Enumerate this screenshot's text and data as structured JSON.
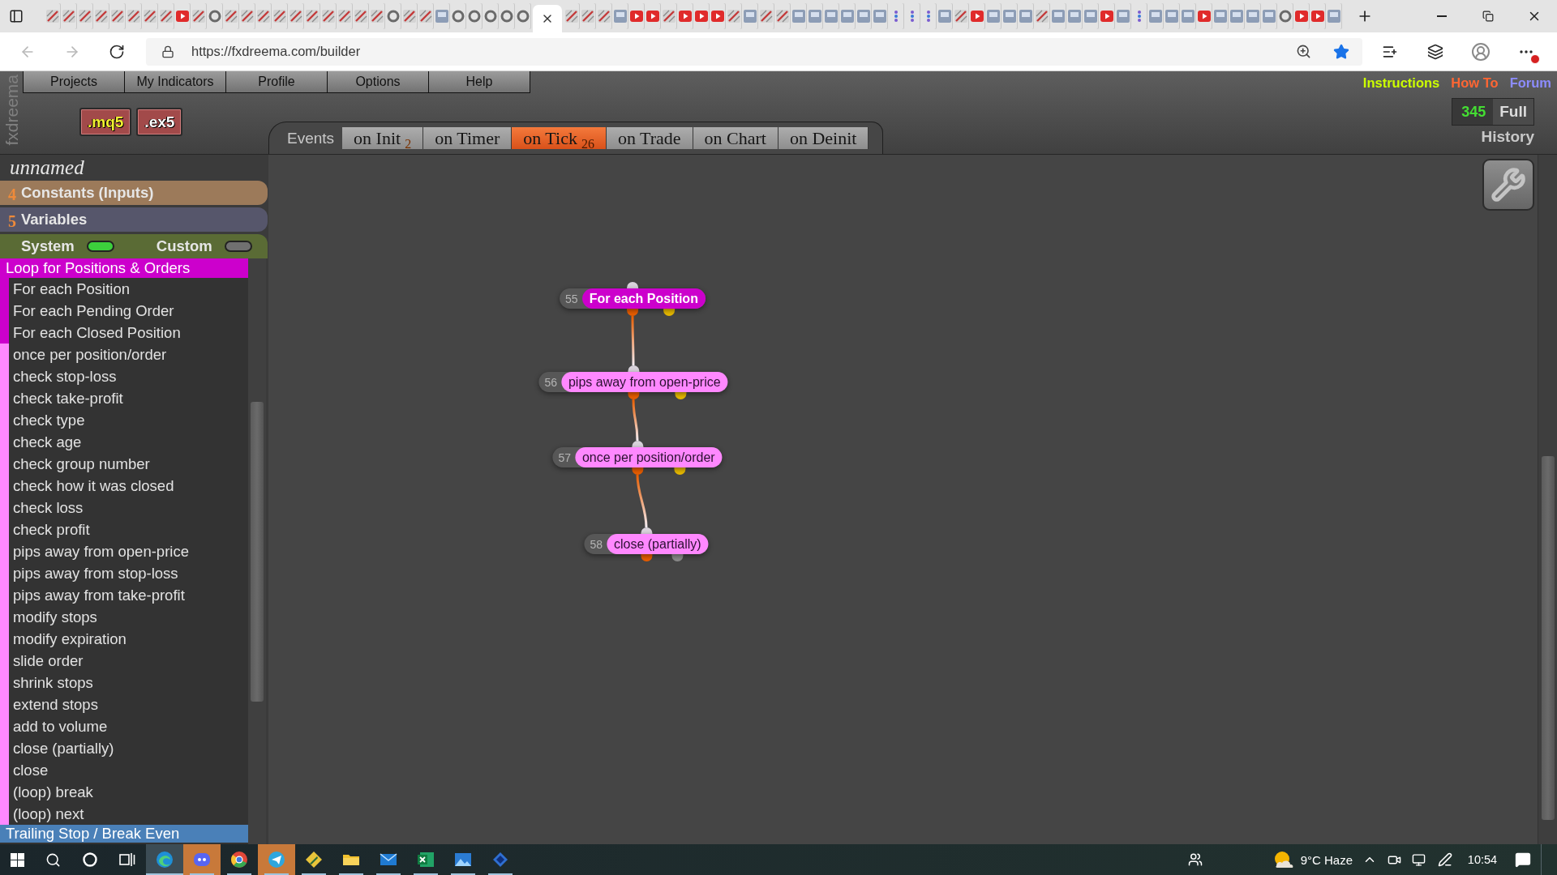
{
  "browser": {
    "tabs": [
      {
        "kind": "pencil",
        "selected": false
      },
      {
        "kind": "pencil",
        "selected": false
      },
      {
        "kind": "pencil",
        "selected": false
      },
      {
        "kind": "pencil",
        "selected": false
      },
      {
        "kind": "pencil",
        "selected": false
      },
      {
        "kind": "pencil",
        "selected": false
      },
      {
        "kind": "pencil",
        "selected": false
      },
      {
        "kind": "pencil",
        "selected": false
      },
      {
        "kind": "play",
        "selected": false
      },
      {
        "kind": "pencil",
        "selected": false
      },
      {
        "kind": "ring",
        "selected": false
      },
      {
        "kind": "pencil",
        "selected": false
      },
      {
        "kind": "pencil",
        "selected": false
      },
      {
        "kind": "pencil",
        "selected": false
      },
      {
        "kind": "pencil",
        "selected": false
      },
      {
        "kind": "pencil",
        "selected": false
      },
      {
        "kind": "pencil",
        "selected": false
      },
      {
        "kind": "pencil",
        "selected": false
      },
      {
        "kind": "pencil",
        "selected": false
      },
      {
        "kind": "pencil",
        "selected": false
      },
      {
        "kind": "pencil",
        "selected": false
      },
      {
        "kind": "ring",
        "selected": false
      },
      {
        "kind": "pencil",
        "selected": false
      },
      {
        "kind": "pencil",
        "selected": false
      },
      {
        "kind": "tile",
        "selected": false
      },
      {
        "kind": "ring",
        "selected": false
      },
      {
        "kind": "ring",
        "selected": false
      },
      {
        "kind": "ring",
        "selected": false
      },
      {
        "kind": "ring",
        "selected": false
      },
      {
        "kind": "ring",
        "selected": false
      },
      {
        "selected": true
      },
      {
        "kind": "pencil",
        "selected": false
      },
      {
        "kind": "pencil",
        "selected": false
      },
      {
        "kind": "pencil",
        "selected": false
      },
      {
        "kind": "tile",
        "selected": false
      },
      {
        "kind": "play",
        "selected": false
      },
      {
        "kind": "play",
        "selected": false
      },
      {
        "kind": "pencil",
        "selected": false
      },
      {
        "kind": "play",
        "selected": false
      },
      {
        "kind": "play",
        "selected": false
      },
      {
        "kind": "play",
        "selected": false
      },
      {
        "kind": "pencil",
        "selected": false
      },
      {
        "kind": "tile",
        "selected": false
      },
      {
        "kind": "pencil",
        "selected": false
      },
      {
        "kind": "pencil",
        "selected": false
      },
      {
        "kind": "tile",
        "selected": false
      },
      {
        "kind": "tile",
        "selected": false
      },
      {
        "kind": "tile",
        "selected": false
      },
      {
        "kind": "tile",
        "selected": false
      },
      {
        "kind": "tile",
        "selected": false
      },
      {
        "kind": "tile",
        "selected": false
      },
      {
        "kind": "dots",
        "selected": false
      },
      {
        "kind": "dots",
        "selected": false
      },
      {
        "kind": "dots",
        "selected": false
      },
      {
        "kind": "tile",
        "selected": false
      },
      {
        "kind": "pencil",
        "selected": false
      },
      {
        "kind": "play",
        "selected": false
      },
      {
        "kind": "tile",
        "selected": false
      },
      {
        "kind": "tile",
        "selected": false
      },
      {
        "kind": "tile",
        "selected": false
      },
      {
        "kind": "pencil",
        "selected": false
      },
      {
        "kind": "tile",
        "selected": false
      },
      {
        "kind": "tile",
        "selected": false
      },
      {
        "kind": "tile",
        "selected": false
      },
      {
        "kind": "play",
        "selected": false
      },
      {
        "kind": "tile",
        "selected": false
      },
      {
        "kind": "dots",
        "selected": false
      },
      {
        "kind": "tile",
        "selected": false
      },
      {
        "kind": "tile",
        "selected": false
      },
      {
        "kind": "tile",
        "selected": false
      },
      {
        "kind": "play",
        "selected": false
      },
      {
        "kind": "tile",
        "selected": false
      },
      {
        "kind": "tile",
        "selected": false
      },
      {
        "kind": "tile",
        "selected": false
      },
      {
        "kind": "tile",
        "selected": false
      },
      {
        "kind": "ring",
        "selected": false
      },
      {
        "kind": "play",
        "selected": false
      },
      {
        "kind": "play",
        "selected": false
      },
      {
        "kind": "tile",
        "selected": false
      }
    ],
    "url": "https://fxdreema.com/builder",
    "bookmarked": true
  },
  "app": {
    "brand": "fxdreema",
    "menu": [
      "Projects",
      "My Indicators",
      "Profile",
      "Options",
      "Help"
    ],
    "export_buttons": [
      {
        "label": ".mq5",
        "kind": "source"
      },
      {
        "label": ".ex5",
        "kind": "binary"
      }
    ],
    "links": [
      {
        "label": "Instructions",
        "color": "#ccff00"
      },
      {
        "label": "How To",
        "color": "#ff6633"
      },
      {
        "label": "Forum",
        "color": "#8c8cff"
      }
    ],
    "history": {
      "count": "345",
      "mode": "Full",
      "title": "History"
    }
  },
  "events": {
    "label": "Events",
    "tabs": [
      {
        "label": "on Init",
        "count": "2",
        "selected": false
      },
      {
        "label": "on Timer",
        "selected": false
      },
      {
        "label": "on Tick",
        "count": "26",
        "selected": true
      },
      {
        "label": "on Trade",
        "selected": false
      },
      {
        "label": "on Chart",
        "selected": false
      },
      {
        "label": "on Deinit",
        "selected": false
      }
    ]
  },
  "sidebar": {
    "project_name": "unnamed",
    "sections": [
      {
        "count": "4",
        "label": "Constants (Inputs)",
        "color": "#9c7a5a"
      },
      {
        "count": "5",
        "label": "Variables",
        "color": "#56566b"
      }
    ],
    "filters": [
      {
        "label": "System",
        "on": true
      },
      {
        "label": "Custom",
        "on": false
      }
    ],
    "categories": [
      {
        "label": "Loop for Positions & Orders",
        "color": "#cc00cc",
        "blocks": [
          {
            "label": "For each Position",
            "color": "#cc00cc"
          },
          {
            "label": "For each Pending Order",
            "color": "#cc00cc"
          },
          {
            "label": "For each Closed Position",
            "color": "#cc00cc"
          },
          {
            "label": "once per position/order",
            "color": "#ff88ff"
          },
          {
            "label": "check stop-loss",
            "color": "#ff88ff"
          },
          {
            "label": "check take-profit",
            "color": "#ff88ff"
          },
          {
            "label": "check type",
            "color": "#ff88ff"
          },
          {
            "label": "check age",
            "color": "#ff88ff"
          },
          {
            "label": "check group number",
            "color": "#ff88ff"
          },
          {
            "label": "check how it was closed",
            "color": "#ff88ff"
          },
          {
            "label": "check loss",
            "color": "#ff88ff"
          },
          {
            "label": "check profit",
            "color": "#ff88ff"
          },
          {
            "label": "pips away from open-price",
            "color": "#ff88ff"
          },
          {
            "label": "pips away from stop-loss",
            "color": "#ff88ff"
          },
          {
            "label": "pips away from take-profit",
            "color": "#ff88ff"
          },
          {
            "label": "modify stops",
            "color": "#ff88ff"
          },
          {
            "label": "modify expiration",
            "color": "#ff88ff"
          },
          {
            "label": "slide order",
            "color": "#ff88ff"
          },
          {
            "label": "shrink stops",
            "color": "#ff88ff"
          },
          {
            "label": "extend stops",
            "color": "#ff88ff"
          },
          {
            "label": "add to volume",
            "color": "#ff88ff"
          },
          {
            "label": "close (partially)",
            "color": "#ff88ff"
          },
          {
            "label": "close",
            "color": "#ff88ff"
          },
          {
            "label": "(loop) break",
            "color": "#ff88ff"
          },
          {
            "label": "(loop) next",
            "color": "#ff88ff"
          }
        ]
      },
      {
        "label": "Trailing Stop / Break Even",
        "color": "#4a80b8"
      }
    ]
  },
  "canvas": {
    "nodes": [
      {
        "number": "55",
        "label": "For each Position",
        "kind": "loop",
        "color": "#cc00cc",
        "linked": false,
        "outputs": [
          {
            "color": "#e85d00"
          },
          {
            "color": "#e6b800"
          }
        ]
      },
      {
        "number": "56",
        "label": "pips away from open-price",
        "kind": "block",
        "color": "#ff88ff",
        "linked": true,
        "outputs": [
          {
            "color": "#e85d00"
          },
          {
            "color": "#e6b800"
          }
        ]
      },
      {
        "number": "57",
        "label": "once per position/order",
        "kind": "block",
        "color": "#ff88ff",
        "linked": true,
        "outputs": [
          {
            "color": "#e85d00"
          },
          {
            "color": "#e6b800"
          }
        ]
      },
      {
        "number": "58",
        "label": "close (partially)",
        "kind": "block",
        "color": "#ff88ff",
        "linked": true,
        "outputs": [
          {
            "color": "#e85d00"
          },
          {
            "color": "#8a8a8a"
          }
        ]
      }
    ]
  },
  "taskbar": {
    "apps": [
      {
        "kind": "browser",
        "active": true,
        "attention": false
      },
      {
        "kind": "chat",
        "active": false,
        "attention": true
      },
      {
        "kind": "wheel",
        "active": false,
        "attention": false
      },
      {
        "kind": "plane",
        "active": false,
        "attention": true
      },
      {
        "kind": "pen",
        "active": false,
        "attention": false
      },
      {
        "kind": "folder",
        "active": false,
        "attention": false
      },
      {
        "kind": "mail",
        "active": false,
        "attention": false
      },
      {
        "kind": "sheet",
        "active": false,
        "attention": false
      },
      {
        "kind": "picture",
        "active": false,
        "attention": false
      },
      {
        "kind": "diamond",
        "active": false,
        "attention": false
      }
    ],
    "weather": "9°C Haze",
    "time": "10:54"
  }
}
